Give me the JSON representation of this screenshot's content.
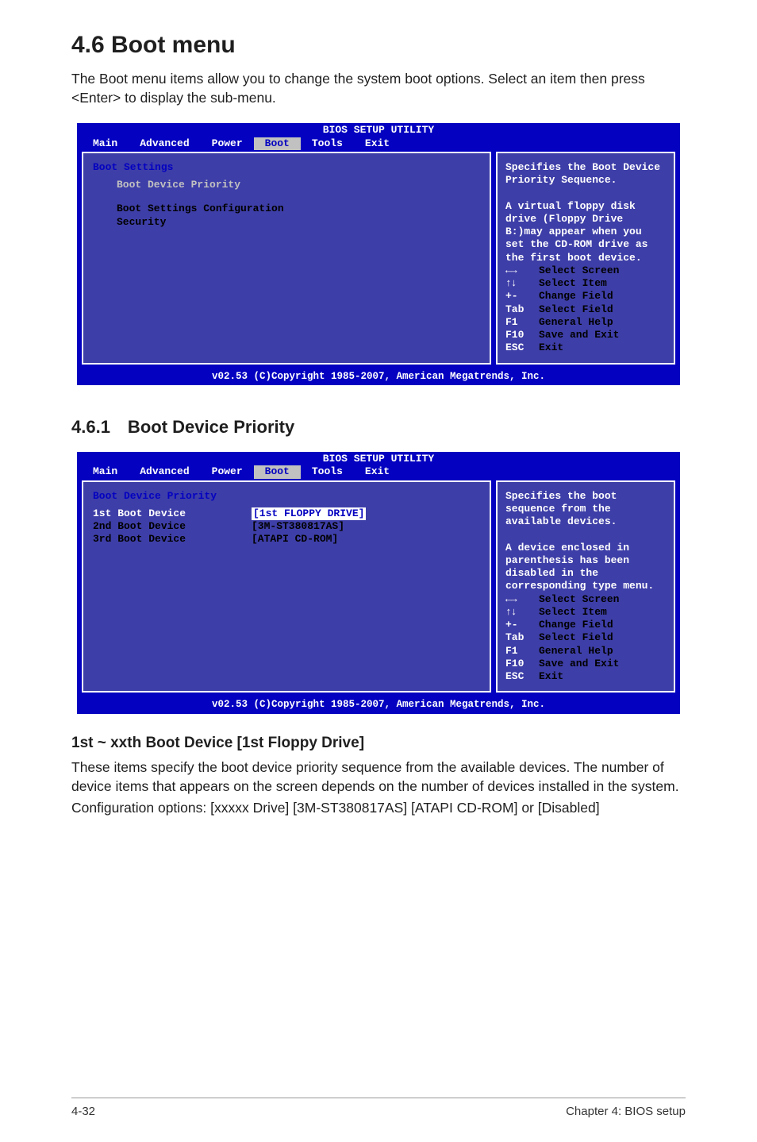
{
  "title": "4.6     Boot menu",
  "intro": "The Boot menu items allow you to change the system boot options. Select an item then press <Enter> to display the sub-menu.",
  "bios1": {
    "app_title": "BIOS SETUP UTILITY",
    "tabs": [
      "Main",
      "Advanced",
      "Power",
      "Boot",
      "Tools",
      "Exit"
    ],
    "active_tab": "Boot",
    "left": {
      "heading": "Boot Settings",
      "items": [
        "Boot Device Priority",
        "Boot Settings Configuration",
        "Security"
      ]
    },
    "right_help": "Specifies the Boot Device Priority Sequence.\n\nA virtual floppy disk drive (Floppy Drive B:)may appear when you set the CD-ROM drive as the first boot device.",
    "legend": [
      {
        "k": "←→",
        "d": "Select Screen"
      },
      {
        "k": "↑↓",
        "d": "Select Item"
      },
      {
        "k": "+-",
        "d": "Change Field"
      },
      {
        "k": "Tab",
        "d": "Select Field"
      },
      {
        "k": "F1",
        "d": "General Help"
      },
      {
        "k": "F10",
        "d": "Save and Exit"
      },
      {
        "k": "ESC",
        "d": "Exit"
      }
    ],
    "footer": "v02.53 (C)Copyright 1985-2007, American Megatrends, Inc."
  },
  "subsection": "4.6.1 Boot Device Priority",
  "bios2": {
    "app_title": "BIOS SETUP UTILITY",
    "tabs": [
      "Main",
      "Advanced",
      "Power",
      "Boot",
      "Tools",
      "Exit"
    ],
    "active_tab": "Boot",
    "left": {
      "heading": "Boot Device Priority",
      "rows": [
        {
          "label": "1st Boot Device",
          "value": "[1st FLOPPY DRIVE]"
        },
        {
          "label": "2nd Boot Device",
          "value": "[3M-ST380817AS]"
        },
        {
          "label": "3rd Boot Device",
          "value": "[ATAPI CD-ROM]"
        }
      ]
    },
    "right_help": "Specifies the boot sequence from the available devices.\n\nA device enclosed in parenthesis has been disabled in the corresponding type menu.",
    "legend": [
      {
        "k": "←→",
        "d": "Select Screen"
      },
      {
        "k": "↑↓",
        "d": "Select Item"
      },
      {
        "k": "+-",
        "d": "Change Field"
      },
      {
        "k": "Tab",
        "d": "Select Field"
      },
      {
        "k": "F1",
        "d": "General Help"
      },
      {
        "k": "F10",
        "d": "Save and Exit"
      },
      {
        "k": "ESC",
        "d": "Exit"
      }
    ],
    "footer": "v02.53 (C)Copyright 1985-2007, American Megatrends, Inc."
  },
  "subhead": "1st ~ xxth Boot Device [1st Floppy Drive]",
  "body1": "These items specify the boot device priority sequence from the available devices. The number of device items that appears on the screen depends on the number of devices installed in the system.",
  "body2": "Configuration options: [xxxxx Drive] [3M-ST380817AS] [ATAPI CD-ROM] or [Disabled]",
  "footer_left": "4-32",
  "footer_right": "Chapter 4: BIOS setup"
}
